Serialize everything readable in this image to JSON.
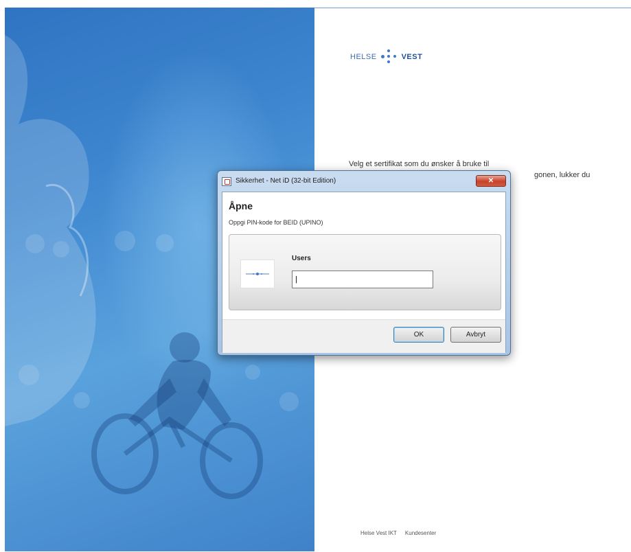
{
  "page": {
    "intro_line1": "Velg et sertifikat som du ønsker å bruke til",
    "intro_line2": "gonen, lukker du",
    "footer_links": [
      "Helse Vest IKT",
      "Kundesenter"
    ]
  },
  "logo": {
    "word1": "HELSE",
    "word2": "VEST"
  },
  "dialog": {
    "title": "Sikkerhet - Net iD (32-bit Edition)",
    "heading": "Åpne",
    "subheading": "Oppgi PIN-kode for BEID (UPINO)",
    "user_label": "Users",
    "pin_value": "|",
    "ok_label": "OK",
    "cancel_label": "Avbryt"
  },
  "colors": {
    "brand_blue": "#1f4f9a",
    "left_panel": "#3e86cf",
    "close_red": "#c7422b"
  }
}
